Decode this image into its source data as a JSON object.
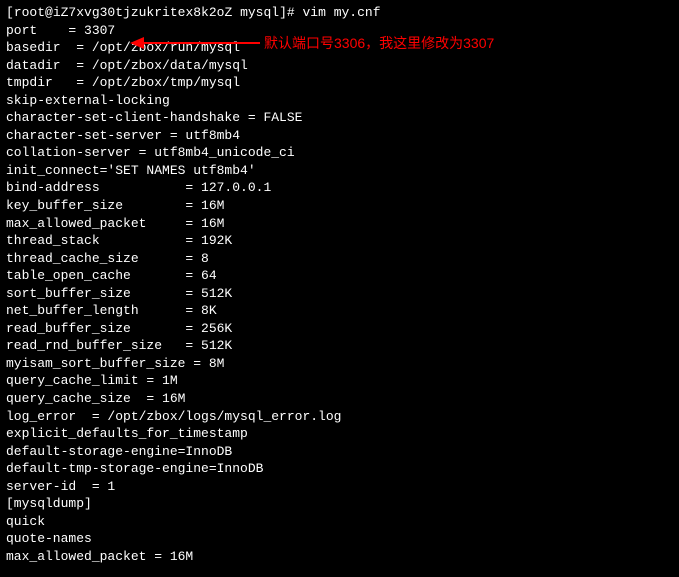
{
  "prompt": {
    "user_host": "root@iZ7xvg30tjzukritex8k2oZ",
    "cwd": "mysql",
    "command": "vim my.cnf"
  },
  "annotation": {
    "text": "默认端口号3306，我这里修改为3307"
  },
  "lines": {
    "l0": "",
    "l1": "port    = 3307",
    "l2": "basedir  = /opt/zbox/run/mysql",
    "l3": "datadir  = /opt/zbox/data/mysql",
    "l4": "tmpdir   = /opt/zbox/tmp/mysql",
    "l5": "skip-external-locking",
    "l6": "",
    "l7": "character-set-client-handshake = FALSE",
    "l8": "character-set-server = utf8mb4",
    "l9": "collation-server = utf8mb4_unicode_ci",
    "l10": "init_connect='SET NAMES utf8mb4'",
    "l11": "",
    "l12": "bind-address           = 127.0.0.1",
    "l13": "key_buffer_size        = 16M",
    "l14": "max_allowed_packet     = 16M",
    "l15": "thread_stack           = 192K",
    "l16": "thread_cache_size      = 8",
    "l17": "table_open_cache       = 64",
    "l18": "sort_buffer_size       = 512K",
    "l19": "net_buffer_length      = 8K",
    "l20": "read_buffer_size       = 256K",
    "l21": "read_rnd_buffer_size   = 512K",
    "l22": "myisam_sort_buffer_size = 8M",
    "l23": "query_cache_limit = 1M",
    "l24": "query_cache_size  = 16M",
    "l25": "log_error  = /opt/zbox/logs/mysql_error.log",
    "l26": "",
    "l27": "explicit_defaults_for_timestamp",
    "l28": "default-storage-engine=InnoDB",
    "l29": "default-tmp-storage-engine=InnoDB",
    "l30": "",
    "l31": "server-id  = 1",
    "l32": "",
    "l33": "[mysqldump]",
    "l34": "quick",
    "l35": "quote-names",
    "l36": "max_allowed_packet = 16M"
  }
}
